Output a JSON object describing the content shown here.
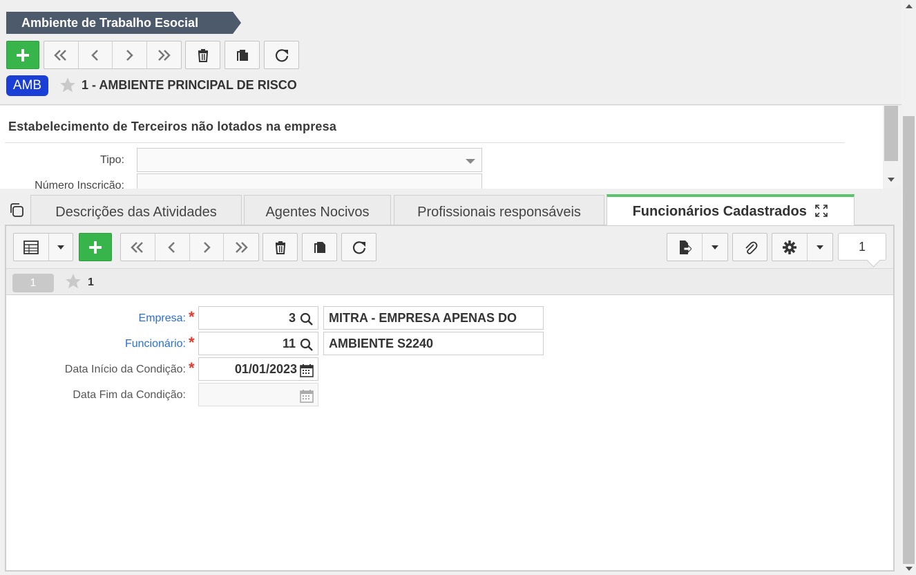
{
  "header": {
    "title": "Ambiente de Trabalho Esocial",
    "badge": "AMB",
    "record_title": "1 - AMBIENTE PRINCIPAL DE RISCO"
  },
  "form": {
    "section_title": "Estabelecimento de Terceiros não lotados na empresa",
    "tipo_label": "Tipo:",
    "tipo_value": "",
    "numero_inscricao_label": "Número Inscrição:"
  },
  "tabs": [
    {
      "label": "Descrições das Atividades"
    },
    {
      "label": "Agentes Nocivos"
    },
    {
      "label": "Profissionais responsáveis"
    },
    {
      "label": "Funcionários Cadastrados",
      "active": true
    }
  ],
  "panel": {
    "record_count": "1",
    "record_pill": "1",
    "record_number": "1",
    "fields": {
      "empresa_label": "Empresa:",
      "empresa_code": "3",
      "empresa_name": "MITRA - EMPRESA APENAS DO",
      "funcionario_label": "Funcionário:",
      "funcionario_code": "11",
      "funcionario_name": "AMBIENTE S2240",
      "data_inicio_label": "Data Início da Condição:",
      "data_inicio_value": "01/01/2023",
      "data_fim_label": "Data Fim da Condição:",
      "data_fim_value": ""
    }
  },
  "colors": {
    "ribbon": "#4d5a6c",
    "badge": "#1a3fd6",
    "add_button": "#38b54a",
    "active_tab_accent": "#5bc36c",
    "link_label": "#2a6fd6",
    "required": "#e03a2f"
  },
  "icons": [
    "plus-icon",
    "first-icon",
    "prev-icon",
    "next-icon",
    "last-icon",
    "trash-icon",
    "copy-icon",
    "refresh-icon",
    "star-icon",
    "grid-icon",
    "caret-down-icon",
    "export-icon",
    "paperclip-icon",
    "gear-icon",
    "search-icon",
    "calendar-icon",
    "expand-icon",
    "duplicate-window-icon"
  ]
}
